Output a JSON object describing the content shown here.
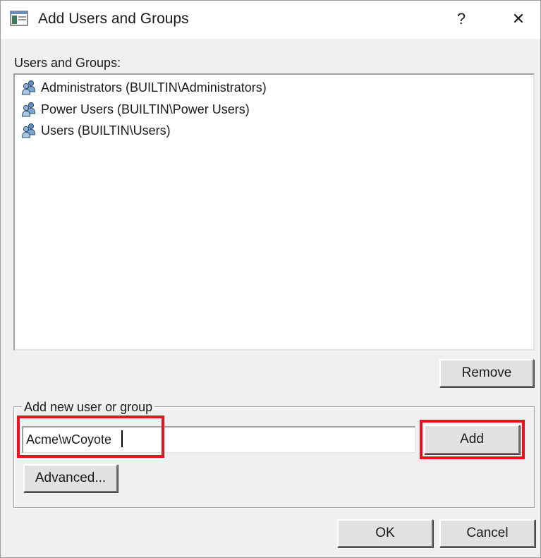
{
  "window": {
    "title": "Add Users and Groups",
    "help_label": "?",
    "close_label": "✕",
    "app_icon": "window-app-icon"
  },
  "users_and_groups": {
    "label": "Users and Groups:",
    "items": [
      {
        "icon": "group-icon",
        "text": "Administrators (BUILTIN\\Administrators)"
      },
      {
        "icon": "group-icon",
        "text": "Power Users (BUILTIN\\Power Users)"
      },
      {
        "icon": "group-icon",
        "text": "Users (BUILTIN\\Users)"
      }
    ],
    "remove_label": "Remove"
  },
  "add_new": {
    "group_label": "Add new user or group",
    "input_value": "Acme\\wCoyote",
    "add_label": "Add",
    "advanced_label": "Advanced..."
  },
  "footer": {
    "ok_label": "OK",
    "cancel_label": "Cancel"
  },
  "colors": {
    "highlight": "#e8131d",
    "dialog_bg": "#f0f0f0",
    "button_bg": "#e1e1e1"
  }
}
